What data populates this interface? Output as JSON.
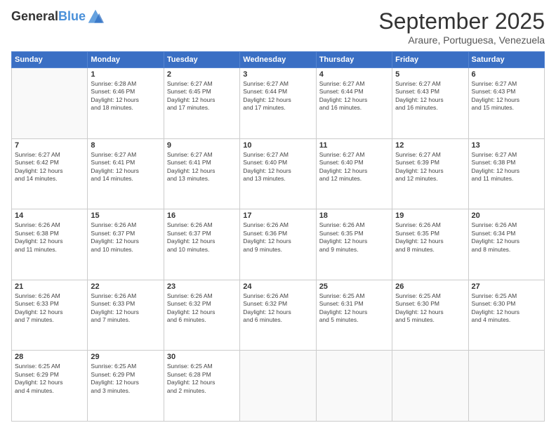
{
  "header": {
    "logo_line1": "General",
    "logo_line2": "Blue",
    "month": "September 2025",
    "location": "Araure, Portuguesa, Venezuela"
  },
  "weekdays": [
    "Sunday",
    "Monday",
    "Tuesday",
    "Wednesday",
    "Thursday",
    "Friday",
    "Saturday"
  ],
  "rows": [
    [
      {
        "day": "",
        "detail": ""
      },
      {
        "day": "1",
        "detail": "Sunrise: 6:28 AM\nSunset: 6:46 PM\nDaylight: 12 hours\nand 18 minutes."
      },
      {
        "day": "2",
        "detail": "Sunrise: 6:27 AM\nSunset: 6:45 PM\nDaylight: 12 hours\nand 17 minutes."
      },
      {
        "day": "3",
        "detail": "Sunrise: 6:27 AM\nSunset: 6:44 PM\nDaylight: 12 hours\nand 17 minutes."
      },
      {
        "day": "4",
        "detail": "Sunrise: 6:27 AM\nSunset: 6:44 PM\nDaylight: 12 hours\nand 16 minutes."
      },
      {
        "day": "5",
        "detail": "Sunrise: 6:27 AM\nSunset: 6:43 PM\nDaylight: 12 hours\nand 16 minutes."
      },
      {
        "day": "6",
        "detail": "Sunrise: 6:27 AM\nSunset: 6:43 PM\nDaylight: 12 hours\nand 15 minutes."
      }
    ],
    [
      {
        "day": "7",
        "detail": "Sunrise: 6:27 AM\nSunset: 6:42 PM\nDaylight: 12 hours\nand 14 minutes."
      },
      {
        "day": "8",
        "detail": "Sunrise: 6:27 AM\nSunset: 6:41 PM\nDaylight: 12 hours\nand 14 minutes."
      },
      {
        "day": "9",
        "detail": "Sunrise: 6:27 AM\nSunset: 6:41 PM\nDaylight: 12 hours\nand 13 minutes."
      },
      {
        "day": "10",
        "detail": "Sunrise: 6:27 AM\nSunset: 6:40 PM\nDaylight: 12 hours\nand 13 minutes."
      },
      {
        "day": "11",
        "detail": "Sunrise: 6:27 AM\nSunset: 6:40 PM\nDaylight: 12 hours\nand 12 minutes."
      },
      {
        "day": "12",
        "detail": "Sunrise: 6:27 AM\nSunset: 6:39 PM\nDaylight: 12 hours\nand 12 minutes."
      },
      {
        "day": "13",
        "detail": "Sunrise: 6:27 AM\nSunset: 6:38 PM\nDaylight: 12 hours\nand 11 minutes."
      }
    ],
    [
      {
        "day": "14",
        "detail": "Sunrise: 6:26 AM\nSunset: 6:38 PM\nDaylight: 12 hours\nand 11 minutes."
      },
      {
        "day": "15",
        "detail": "Sunrise: 6:26 AM\nSunset: 6:37 PM\nDaylight: 12 hours\nand 10 minutes."
      },
      {
        "day": "16",
        "detail": "Sunrise: 6:26 AM\nSunset: 6:37 PM\nDaylight: 12 hours\nand 10 minutes."
      },
      {
        "day": "17",
        "detail": "Sunrise: 6:26 AM\nSunset: 6:36 PM\nDaylight: 12 hours\nand 9 minutes."
      },
      {
        "day": "18",
        "detail": "Sunrise: 6:26 AM\nSunset: 6:35 PM\nDaylight: 12 hours\nand 9 minutes."
      },
      {
        "day": "19",
        "detail": "Sunrise: 6:26 AM\nSunset: 6:35 PM\nDaylight: 12 hours\nand 8 minutes."
      },
      {
        "day": "20",
        "detail": "Sunrise: 6:26 AM\nSunset: 6:34 PM\nDaylight: 12 hours\nand 8 minutes."
      }
    ],
    [
      {
        "day": "21",
        "detail": "Sunrise: 6:26 AM\nSunset: 6:33 PM\nDaylight: 12 hours\nand 7 minutes."
      },
      {
        "day": "22",
        "detail": "Sunrise: 6:26 AM\nSunset: 6:33 PM\nDaylight: 12 hours\nand 7 minutes."
      },
      {
        "day": "23",
        "detail": "Sunrise: 6:26 AM\nSunset: 6:32 PM\nDaylight: 12 hours\nand 6 minutes."
      },
      {
        "day": "24",
        "detail": "Sunrise: 6:26 AM\nSunset: 6:32 PM\nDaylight: 12 hours\nand 6 minutes."
      },
      {
        "day": "25",
        "detail": "Sunrise: 6:25 AM\nSunset: 6:31 PM\nDaylight: 12 hours\nand 5 minutes."
      },
      {
        "day": "26",
        "detail": "Sunrise: 6:25 AM\nSunset: 6:30 PM\nDaylight: 12 hours\nand 5 minutes."
      },
      {
        "day": "27",
        "detail": "Sunrise: 6:25 AM\nSunset: 6:30 PM\nDaylight: 12 hours\nand 4 minutes."
      }
    ],
    [
      {
        "day": "28",
        "detail": "Sunrise: 6:25 AM\nSunset: 6:29 PM\nDaylight: 12 hours\nand 4 minutes."
      },
      {
        "day": "29",
        "detail": "Sunrise: 6:25 AM\nSunset: 6:29 PM\nDaylight: 12 hours\nand 3 minutes."
      },
      {
        "day": "30",
        "detail": "Sunrise: 6:25 AM\nSunset: 6:28 PM\nDaylight: 12 hours\nand 2 minutes."
      },
      {
        "day": "",
        "detail": ""
      },
      {
        "day": "",
        "detail": ""
      },
      {
        "day": "",
        "detail": ""
      },
      {
        "day": "",
        "detail": ""
      }
    ]
  ]
}
